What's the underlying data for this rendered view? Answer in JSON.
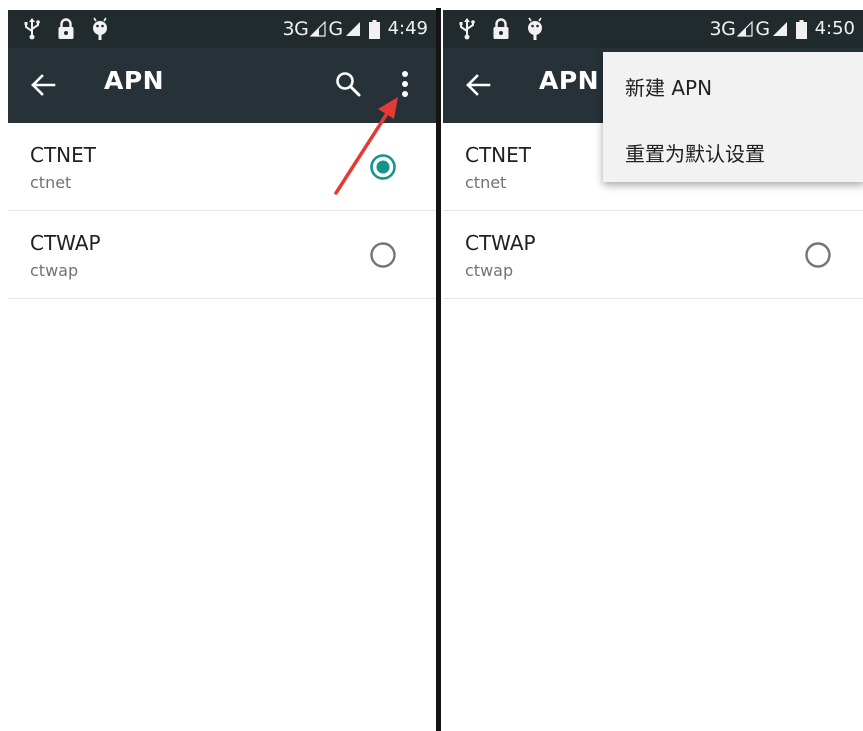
{
  "colors": {
    "status_bar": "#212a2d",
    "app_bar": "#263238",
    "accent": "#139688",
    "menu_bg": "#f2f2f2",
    "annotation_arrow": "#e53935"
  },
  "left": {
    "status": {
      "network": "3G",
      "network2": "G",
      "time": "4:49"
    },
    "app_bar": {
      "title": "APN",
      "back_icon": "arrow-back-icon",
      "search_icon": "search-icon",
      "menu_icon": "overflow-menu-icon"
    },
    "apns": [
      {
        "name": "CTNET",
        "apn": "ctnet",
        "selected": true
      },
      {
        "name": "CTWAP",
        "apn": "ctwap",
        "selected": false
      }
    ]
  },
  "right": {
    "status": {
      "network": "3G",
      "network2": "G",
      "time": "4:50"
    },
    "app_bar": {
      "title": "APN",
      "back_icon": "arrow-back-icon"
    },
    "apns": [
      {
        "name": "CTNET",
        "apn": "ctnet",
        "selected": true
      },
      {
        "name": "CTWAP",
        "apn": "ctwap",
        "selected": false
      }
    ],
    "menu": {
      "items": [
        "新建 APN",
        "重置为默认设置"
      ]
    }
  }
}
